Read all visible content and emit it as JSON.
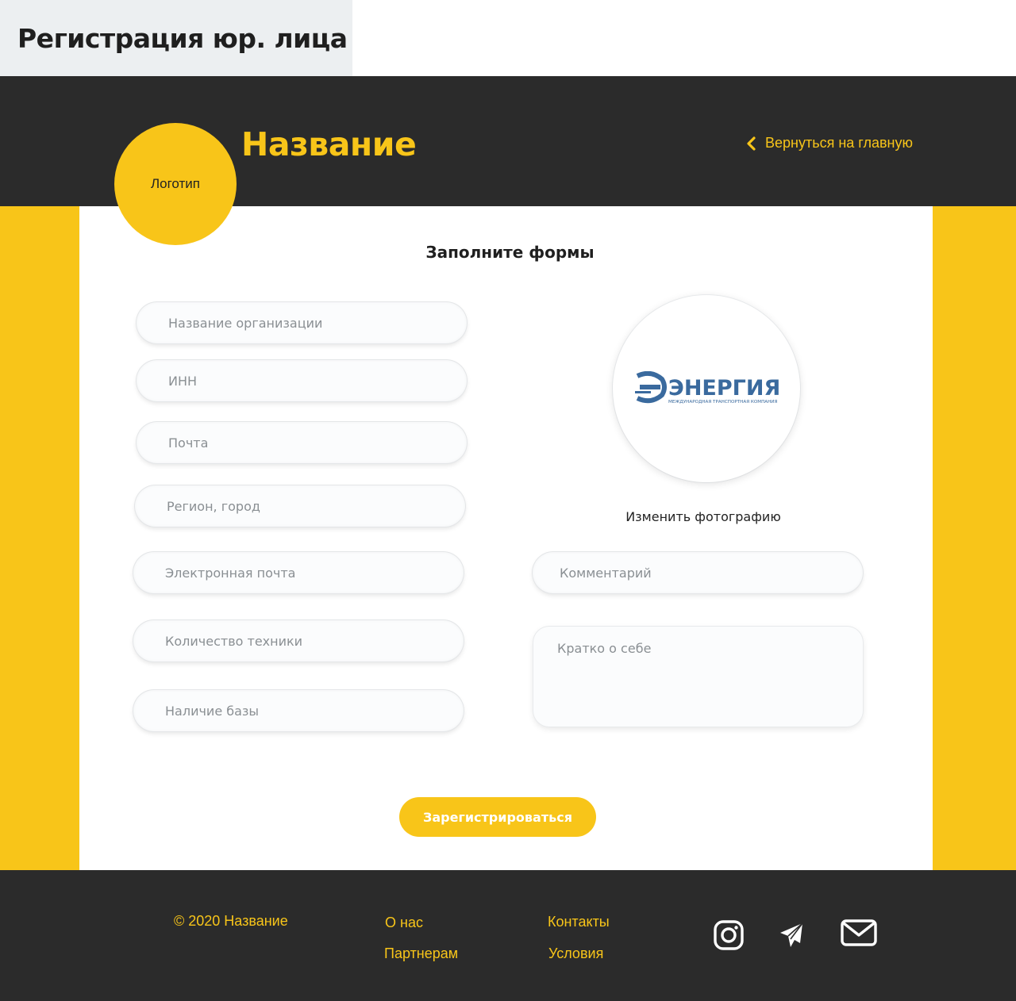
{
  "page_label": "Регистрация юр. лица",
  "header": {
    "logo_label": "Логотип",
    "brand_name": "Название",
    "back_link": "Вернуться на главную"
  },
  "form": {
    "title": "Заполните формы",
    "left_fields": [
      {
        "placeholder": "Название организации"
      },
      {
        "placeholder": "ИНН"
      },
      {
        "placeholder": "Почта"
      },
      {
        "placeholder": "Регион, город"
      },
      {
        "placeholder": "Электронная почта"
      },
      {
        "placeholder": "Количество техники"
      },
      {
        "placeholder": "Наличие базы"
      }
    ],
    "comment_placeholder": "Комментарий",
    "about_placeholder": "Кратко о себе",
    "photo": {
      "company_name": "ЭНЕРГИЯ",
      "company_tagline": "МЕЖДУНАРОДНАЯ ТРАНСПОРТНАЯ КОМПАНИЯ",
      "change_label": "Изменить фотографию"
    },
    "submit_label": "Зарегистрироваться"
  },
  "footer": {
    "copyright": "© 2020 Название",
    "links": {
      "about": "О нас",
      "partners": "Партнерам",
      "contacts": "Контакты",
      "terms": "Условия"
    },
    "social_icons": [
      "instagram-icon",
      "telegram-icon",
      "mail-icon"
    ]
  },
  "colors": {
    "accent": "#f8c519",
    "dark": "#2b2b2b",
    "company_blue": "#3a6a9e"
  }
}
